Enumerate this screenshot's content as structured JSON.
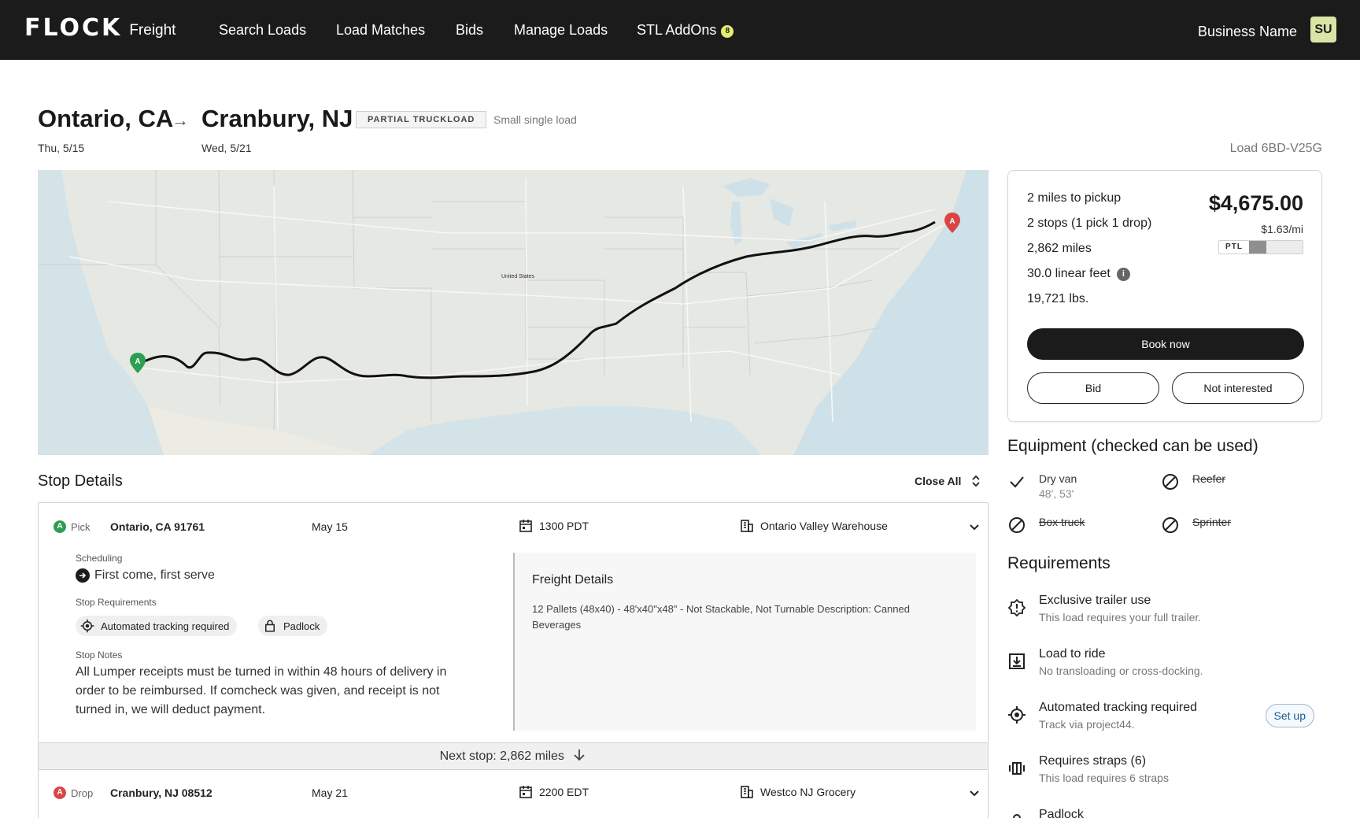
{
  "nav": {
    "logo": "FLOCK",
    "logo_sub": "Freight",
    "links": [
      "Search Loads",
      "Load Matches",
      "Bids",
      "Manage Loads",
      "STL AddOns"
    ],
    "addons_badge": "8",
    "business_name": "Business Name",
    "avatar_initials": "SU"
  },
  "route": {
    "origin": "Ontario, CA",
    "origin_date": "Thu, 5/15",
    "destination": "Cranbury, NJ",
    "destination_date": "Wed, 5/21",
    "type_tag": "PARTIAL TRUCKLOAD",
    "type_note": "Small single load",
    "load_id": "Load 6BD-V25G"
  },
  "map": {
    "country_label": "United States",
    "origin_marker": "A",
    "destination_marker": "A",
    "origin_color": "#2e9e52",
    "destination_color": "#d94545"
  },
  "summary": {
    "stats": [
      "2 miles to pickup",
      "2 stops (1 pick 1 drop)",
      "2,862 miles",
      "30.0 linear feet",
      "19,721 lbs."
    ],
    "price": "$4,675.00",
    "per_mile": "$1.63/mi",
    "ptl_label": "PTL",
    "ptl_fill_fraction": 0.33,
    "book_label": "Book now",
    "bid_label": "Bid",
    "not_interested_label": "Not interested"
  },
  "equipment": {
    "title": "Equipment (checked can be used)",
    "items": [
      {
        "name": "Dry van",
        "sub": "48', 53'",
        "allowed": true
      },
      {
        "name": "Reefer",
        "sub": "",
        "allowed": false
      },
      {
        "name": "Box truck",
        "sub": "",
        "allowed": false
      },
      {
        "name": "Sprinter",
        "sub": "",
        "allowed": false
      }
    ]
  },
  "requirements": {
    "title": "Requirements",
    "items": [
      {
        "name": "Exclusive trailer use",
        "desc": "This load requires your full trailer.",
        "icon": "alert-badge-icon"
      },
      {
        "name": "Load to ride",
        "desc": "No transloading or cross-docking.",
        "icon": "load-box-icon"
      },
      {
        "name": "Automated tracking required",
        "desc": "Track via project44.",
        "icon": "tracking-target-icon",
        "action": "Set up"
      },
      {
        "name": "Requires straps (6)",
        "desc": "This load requires 6 straps",
        "icon": "straps-icon"
      },
      {
        "name": "Padlock",
        "desc": "",
        "icon": "padlock-icon"
      }
    ]
  },
  "stops": {
    "title": "Stop Details",
    "close_all": "Close All",
    "pick": {
      "marker": "A",
      "kind": "Pick",
      "location": "Ontario, CA 91761",
      "date": "May 15",
      "time": "1300 PDT",
      "facility": "Ontario Valley Warehouse",
      "scheduling_label": "Scheduling",
      "scheduling": "First come, first serve",
      "requirements_label": "Stop Requirements",
      "requirements": [
        "Automated tracking required",
        "Padlock"
      ],
      "notes_label": "Stop Notes",
      "notes": "All Lumper receipts must be turned in within 48 hours of delivery in order to be reimbursed. If comcheck was given, and receipt is not turned in, we will deduct payment.",
      "freight_title": "Freight Details",
      "freight_text": "12 Pallets (48x40) - 48'x40\"x48\" - Not Stackable, Not Turnable Description: Canned Beverages"
    },
    "next_stop": "Next stop: 2,862 miles",
    "drop": {
      "marker": "A",
      "kind": "Drop",
      "location": "Cranbury, NJ 08512",
      "date": "May 21",
      "time": "2200 EDT",
      "facility": "Westco NJ Grocery"
    }
  }
}
